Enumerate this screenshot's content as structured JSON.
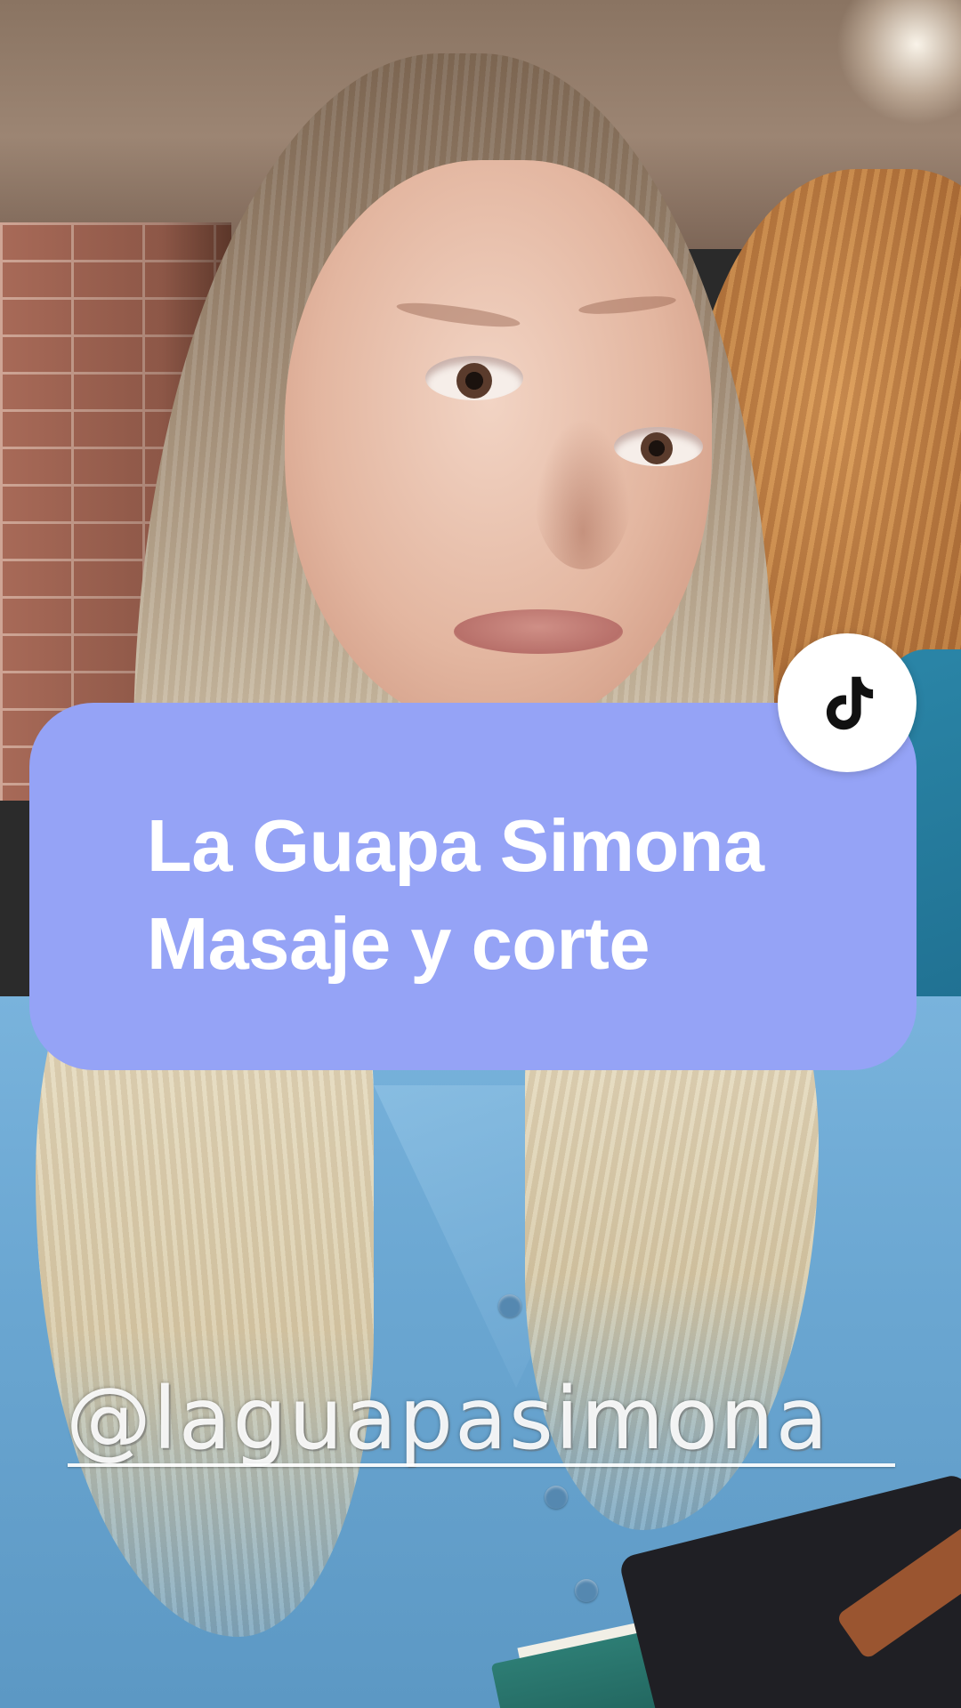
{
  "caption": {
    "lines": [
      "La Guapa Simona",
      "Masaje y corte"
    ],
    "background_color": "#95a3f6",
    "text_color": "#ffffff"
  },
  "badge": {
    "icon": "tiktok-logo-icon",
    "background_color": "#ffffff",
    "icon_color": "#111111"
  },
  "watermark": {
    "handle": "@laguapasimona"
  },
  "scene": {
    "subject": "photo-of-woman-selfie",
    "shirt_color": "#6ba7d2"
  }
}
